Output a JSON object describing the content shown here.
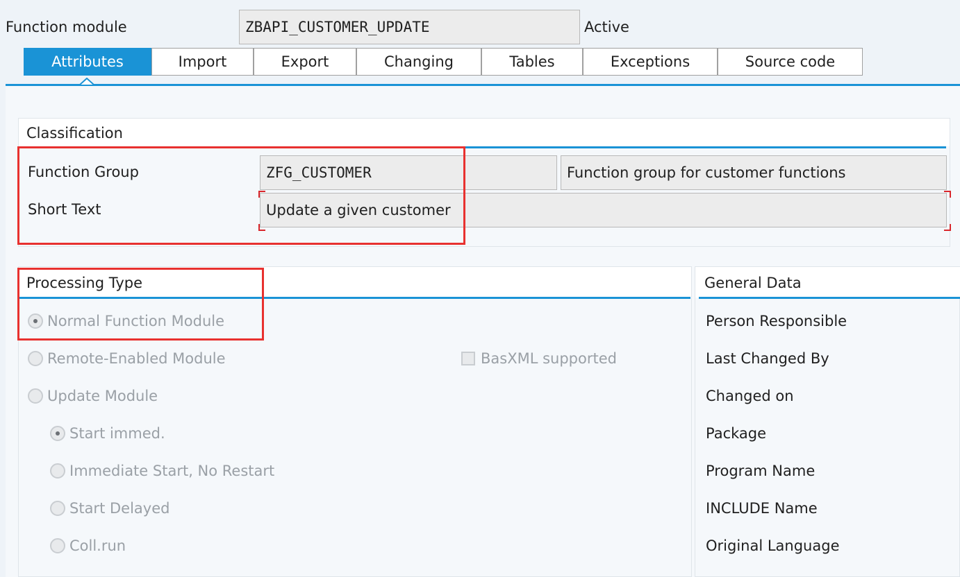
{
  "header": {
    "label": "Function module",
    "module_name": "ZBAPI_CUSTOMER_UPDATE",
    "status": "Active"
  },
  "tabs": [
    {
      "label": "Attributes",
      "active": true
    },
    {
      "label": "Import"
    },
    {
      "label": "Export"
    },
    {
      "label": "Changing"
    },
    {
      "label": "Tables"
    },
    {
      "label": "Exceptions"
    },
    {
      "label": "Source code"
    }
  ],
  "classification": {
    "title": "Classification",
    "function_group_label": "Function Group",
    "function_group_value": "ZFG_CUSTOMER",
    "function_group_desc": "Function group for customer functions",
    "short_text_label": "Short Text",
    "short_text_value": "Update a given customer"
  },
  "processing_type": {
    "title": "Processing Type",
    "options": [
      {
        "label": "Normal Function Module",
        "checked": true
      },
      {
        "label": "Remote-Enabled Module",
        "checked": false
      },
      {
        "label": "Update Module",
        "checked": false
      }
    ],
    "basxml_label": "BasXML supported",
    "basxml_checked": false,
    "update_options": [
      {
        "label": "Start immed.",
        "checked": true
      },
      {
        "label": "Immediate Start, No Restart",
        "checked": false
      },
      {
        "label": "Start Delayed",
        "checked": false
      },
      {
        "label": "Coll.run",
        "checked": false
      }
    ]
  },
  "general_data": {
    "title": "General Data",
    "fields": [
      "Person Responsible",
      "Last Changed By",
      "Changed on",
      "Package",
      "Program Name",
      "INCLUDE Name",
      "Original Language"
    ]
  },
  "colors": {
    "accent": "#1a93d6",
    "highlight": "#e8312f"
  }
}
